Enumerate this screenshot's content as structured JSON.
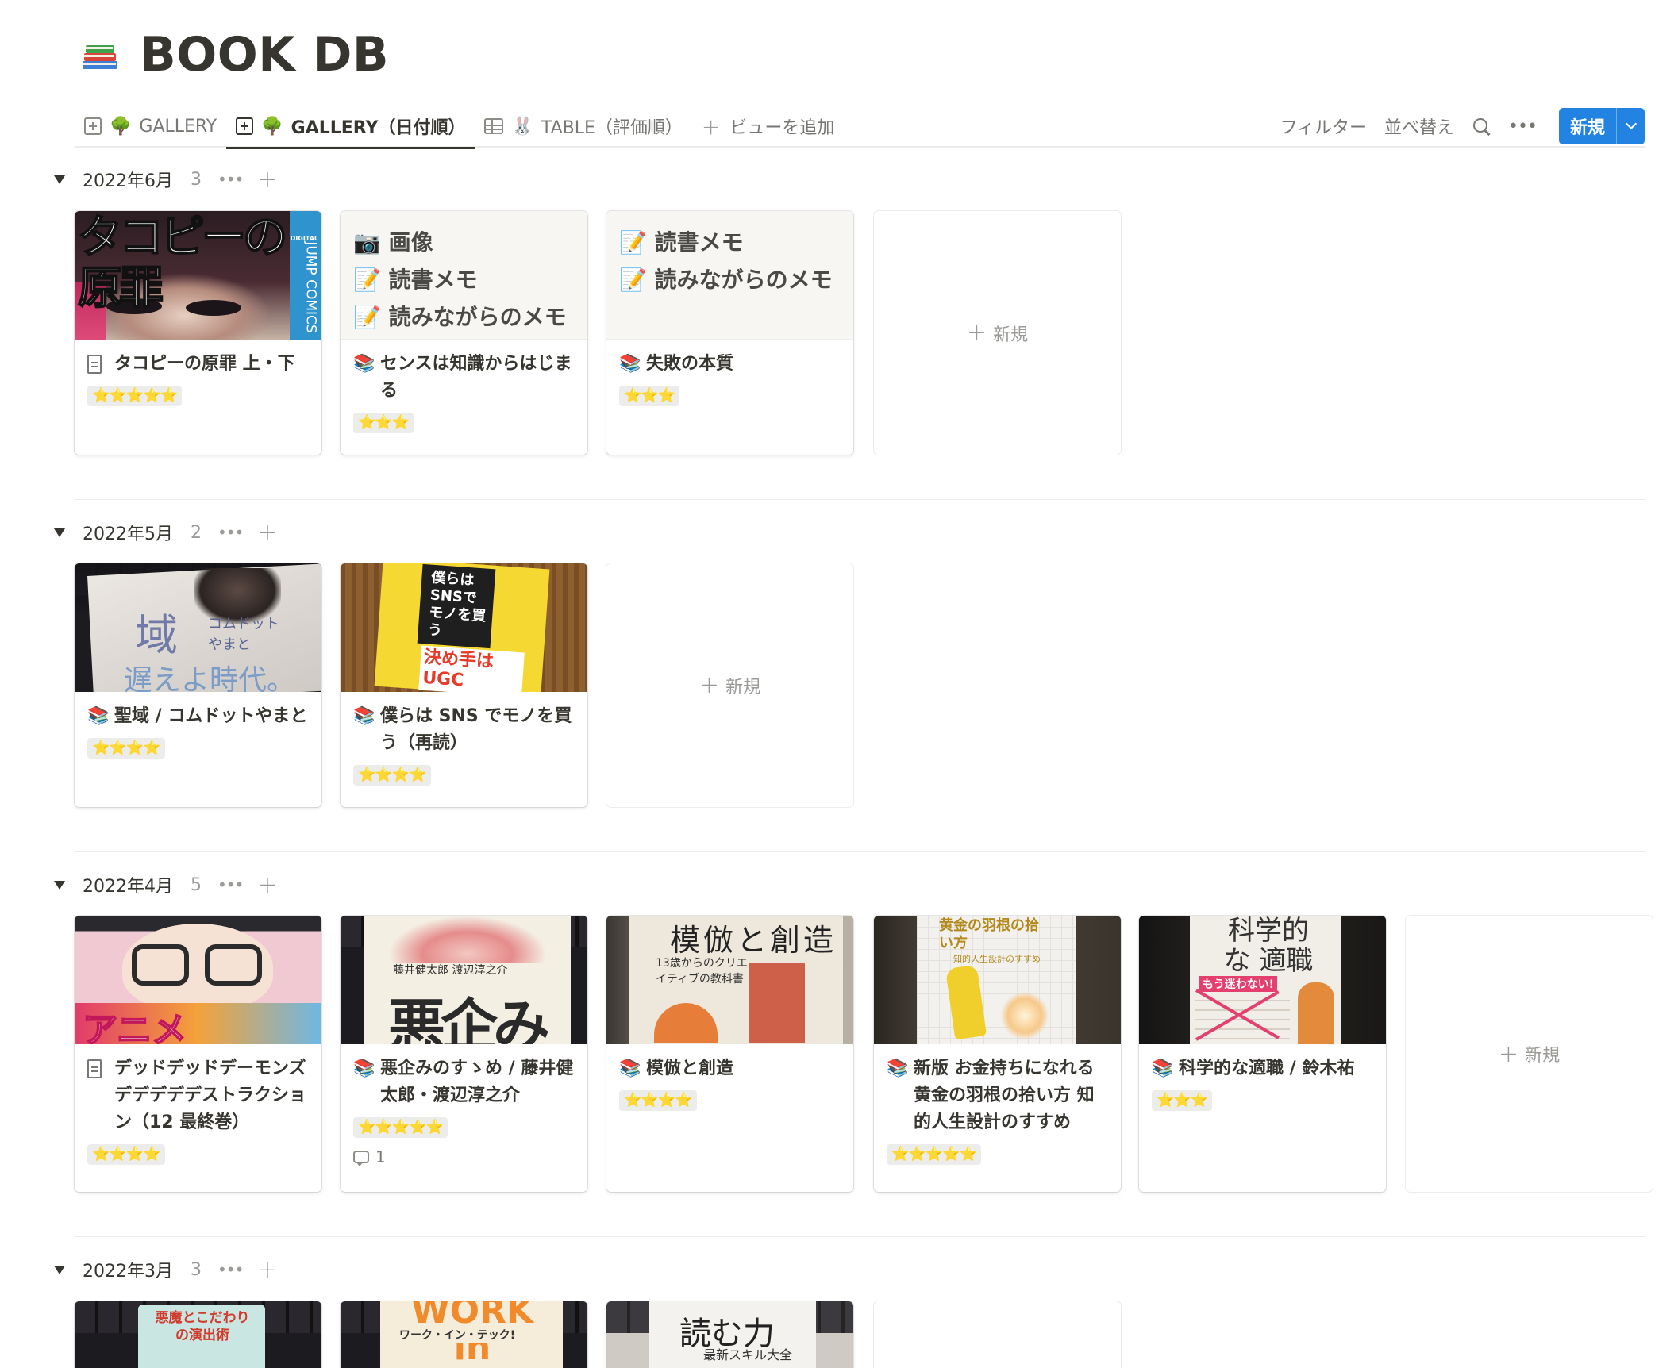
{
  "page": {
    "title": "BOOK DB",
    "title_icon": "books-icon"
  },
  "tabs": [
    {
      "icon": "gallery-icon",
      "emoji": "🌳",
      "label": "GALLERY",
      "active": false
    },
    {
      "icon": "gallery-icon",
      "emoji": "🌳",
      "label": "GALLERY（日付順）",
      "active": true
    },
    {
      "icon": "table-icon",
      "emoji": "🐰",
      "label": "TABLE（評価順）",
      "active": false
    }
  ],
  "add_view": {
    "label": "ビューを追加"
  },
  "toolbar": {
    "filter": "フィルター",
    "sort": "並べ替え",
    "new_label": "新規",
    "accent": "#2383e2"
  },
  "new_card_label": "新規",
  "groups": [
    {
      "name": "2022年6月",
      "count": "3",
      "cards": [
        {
          "icon": "page-icon",
          "title": "タコピーの原罪 上・下",
          "stars": "⭐⭐⭐⭐⭐",
          "cover": "tacopi-cover"
        },
        {
          "icon": "books-icon",
          "title": "センスは知識からはじまる",
          "stars": "⭐⭐⭐",
          "preview": [
            "📷 画像",
            "📝 読書メモ",
            "📝 読みながらのメモ"
          ]
        },
        {
          "icon": "books-icon",
          "title": "失敗の本質",
          "stars": "⭐⭐⭐",
          "preview": [
            "📝 読書メモ",
            "📝 読みながらのメモ"
          ]
        }
      ]
    },
    {
      "name": "2022年5月",
      "count": "2",
      "cards": [
        {
          "icon": "books-icon",
          "title": "聖域 / コムドットやまと",
          "stars": "⭐⭐⭐⭐",
          "cover": "seiiki-cover"
        },
        {
          "icon": "books-icon",
          "title": "僕らは SNS でモノを買う（再読）",
          "stars": "⭐⭐⭐⭐",
          "cover": "sns-cover"
        }
      ]
    },
    {
      "name": "2022年4月",
      "count": "5",
      "cards": [
        {
          "icon": "page-icon",
          "title": "デッドデッドデーモンズ デデデデデストラクション（12 最終巻）",
          "stars": "⭐⭐⭐⭐",
          "cover": "dedede-cover"
        },
        {
          "icon": "books-icon",
          "title": "悪企みのすゝめ / 藤井健太郎・渡辺淳之介",
          "stars": "⭐⭐⭐⭐⭐",
          "comments": "1",
          "cover": "warudakumi-cover"
        },
        {
          "icon": "books-icon",
          "title": "模倣と創造",
          "stars": "⭐⭐⭐⭐",
          "cover": "mohou-cover"
        },
        {
          "icon": "books-icon",
          "title": "新版 お金持ちになれる黄金の羽根の拾い方 知的人生設計のすすめ",
          "stars": "⭐⭐⭐⭐⭐",
          "cover": "ougon-cover"
        },
        {
          "icon": "books-icon",
          "title": "科学的な適職 / 鈴木祐",
          "stars": "⭐⭐⭐",
          "cover": "tekishoku-cover"
        }
      ]
    },
    {
      "name": "2022年3月",
      "count": "3",
      "cards": [
        {
          "cover": "akuma-cover"
        },
        {
          "cover": "work-in-tech-cover"
        },
        {
          "cover": "yomuchikara-cover"
        }
      ]
    }
  ],
  "cover_text": {
    "tacopi": {
      "title": "タコピーの原罪",
      "side": "JUMP COMICS",
      "badge": "DIGITAL"
    },
    "seiiki": {
      "big": "域",
      "author": "コムドット やまと",
      "sub": "遅えよ時代。"
    },
    "sns": {
      "title": "僕らはSNSでモノを買う",
      "sub": "決め手は UGC"
    },
    "dedede": {
      "title": "アニメ"
    },
    "warudakumi": {
      "title": "悪企み",
      "authors": "藤井健太郎 渡辺淳之介"
    },
    "mohou": {
      "title": "模倣と創造",
      "sub": "13歳からのクリエイティブの教科書"
    },
    "ougon": {
      "title": "黄金の羽根の拾い方",
      "sub": "知的人生設計のすすめ"
    },
    "tekishoku": {
      "title": "科学的な 適職",
      "sub": "もう迷わない!"
    },
    "akuma": {
      "title": "悪魔とこだわりの演出術"
    },
    "work": {
      "title": "WORK in",
      "sub": "ワーク・イン・テック!"
    },
    "yomu": {
      "title": "読む力",
      "sub": "最新スキル大全"
    }
  }
}
